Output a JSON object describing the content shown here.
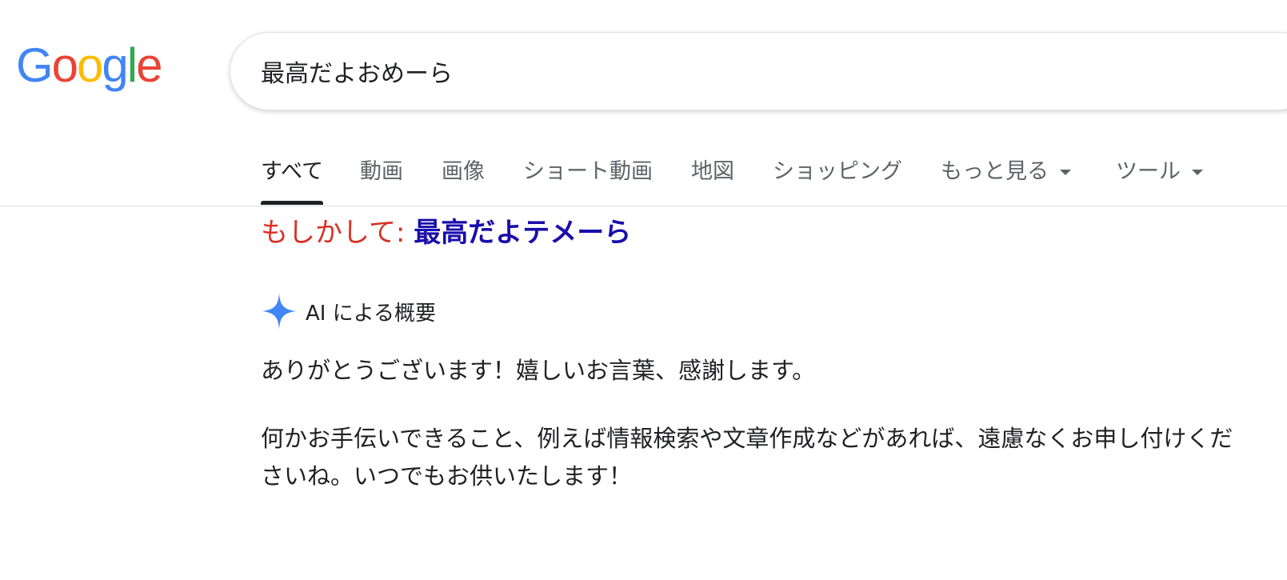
{
  "logo": {
    "letters": [
      "G",
      "o",
      "o",
      "g",
      "l",
      "e"
    ],
    "colors": [
      "#4285F4",
      "#EA4335",
      "#FBBC05",
      "#4285F4",
      "#34A853",
      "#EA4335"
    ]
  },
  "search": {
    "value": "最高だよおめーら"
  },
  "tabs": [
    {
      "label": "すべて",
      "active": true
    },
    {
      "label": "動画"
    },
    {
      "label": "画像"
    },
    {
      "label": "ショート動画"
    },
    {
      "label": "地図"
    },
    {
      "label": "ショッピング"
    },
    {
      "label": "もっと見る",
      "dropdown": true
    },
    {
      "label": "ツール",
      "dropdown": true
    }
  ],
  "did_you_mean": {
    "label": "もしかして:",
    "suggestion": "最高だよテメーら"
  },
  "ai_overview": {
    "icon": "sparkle-icon",
    "title": "AI による概要",
    "paragraphs": [
      "ありがとうございます！嬉しいお言葉、感謝します。",
      "何かお手伝いできること、例えば情報検索や文章作成などがあれば、遠慮なくお申し付けくださいね。いつでもお供いたします！"
    ]
  },
  "colors": {
    "link": "#1a0dab",
    "did_you_mean": "#d93025",
    "sparkle": "#4285F4"
  }
}
